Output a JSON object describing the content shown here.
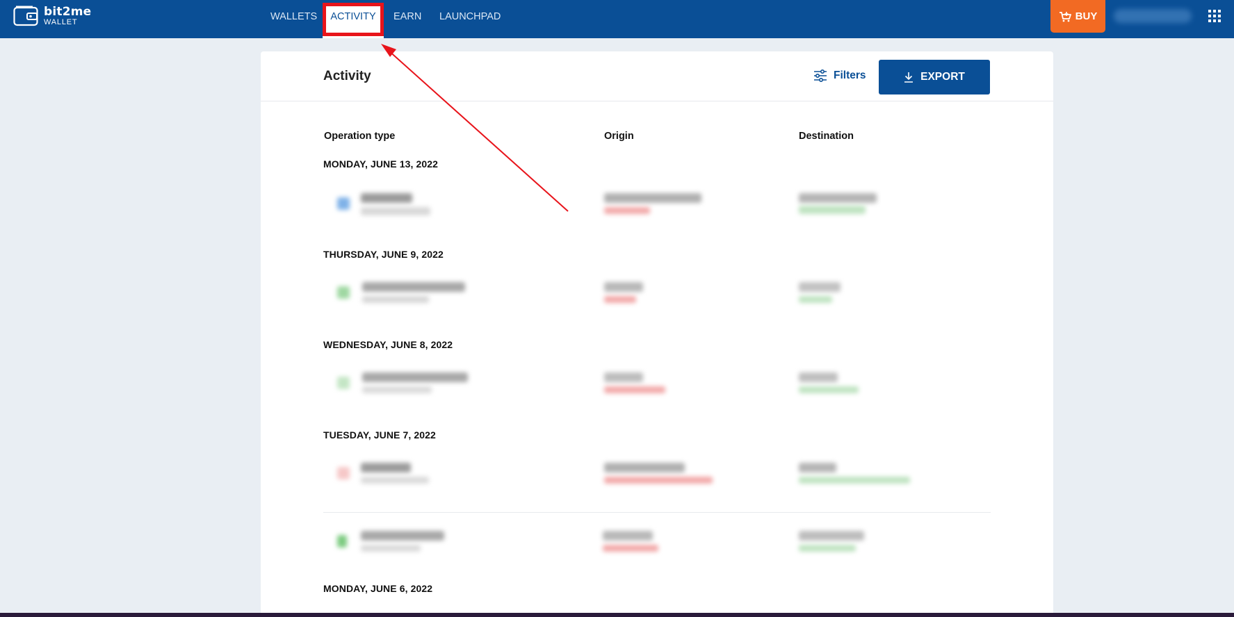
{
  "app": {
    "name": "bit2me",
    "sub": "WALLET"
  },
  "nav": {
    "wallets": "WALLETS",
    "activity": "ACTIVITY",
    "earn": "EARN",
    "launchpad": "LAUNCHPAD"
  },
  "header": {
    "buy_label": "BUY"
  },
  "activity": {
    "title": "Activity",
    "filters_label": "Filters",
    "export_label": "EXPORT",
    "columns": {
      "operation_type": "Operation type",
      "origin": "Origin",
      "destination": "Destination"
    },
    "dates": [
      "MONDAY, JUNE 13, 2022",
      "THURSDAY, JUNE 9, 2022",
      "WEDNESDAY, JUNE 8, 2022",
      "TUESDAY, JUNE 7, 2022",
      "MONDAY, JUNE 6, 2022"
    ]
  },
  "colors": {
    "brand": "#0a4f96",
    "buy": "#f26a23",
    "annotation": "#e8141b",
    "negative": "#e53935",
    "positive": "#43a047"
  }
}
